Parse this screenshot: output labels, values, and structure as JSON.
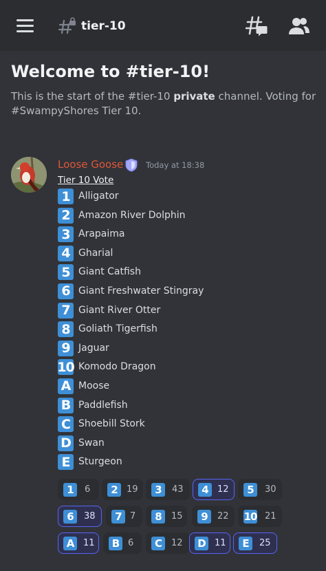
{
  "header": {
    "channel_name": "tier-10",
    "menu_icon": "hamburger-menu-icon",
    "channel_icon": "locked-hashtag-icon",
    "threads_icon": "threads-icon",
    "members_icon": "members-icon"
  },
  "welcome": {
    "title": "Welcome to #tier-10!",
    "desc_prefix": "This is the start of the #tier-10 ",
    "desc_bold": "private",
    "desc_suffix": " channel. Voting for #SwampyShores Tier 10."
  },
  "message": {
    "author": "Loose Goose",
    "author_color": "#e0573a",
    "badge_icon": "shield-badge-icon",
    "timestamp": "Today at 18:38",
    "title": "Tier 10 Vote",
    "options": [
      {
        "key": "1",
        "label": "Alligator"
      },
      {
        "key": "2",
        "label": "Amazon River Dolphin"
      },
      {
        "key": "3",
        "label": "Arapaima"
      },
      {
        "key": "4",
        "label": "Gharial"
      },
      {
        "key": "5",
        "label": "Giant Catfish"
      },
      {
        "key": "6",
        "label": "Giant Freshwater Stingray"
      },
      {
        "key": "7",
        "label": "Giant River Otter"
      },
      {
        "key": "8",
        "label": "Goliath Tigerfish"
      },
      {
        "key": "9",
        "label": "Jaguar"
      },
      {
        "key": "10",
        "label": "Komodo Dragon"
      },
      {
        "key": "A",
        "label": "Moose"
      },
      {
        "key": "B",
        "label": "Paddlefish"
      },
      {
        "key": "C",
        "label": "Shoebill Stork"
      },
      {
        "key": "D",
        "label": "Swan"
      },
      {
        "key": "E",
        "label": "Sturgeon"
      }
    ]
  },
  "reactions": [
    {
      "key": "1",
      "count": "6",
      "active": false
    },
    {
      "key": "2",
      "count": "19",
      "active": false
    },
    {
      "key": "3",
      "count": "43",
      "active": false
    },
    {
      "key": "4",
      "count": "12",
      "active": true
    },
    {
      "key": "5",
      "count": "30",
      "active": false
    },
    {
      "key": "6",
      "count": "38",
      "active": true
    },
    {
      "key": "7",
      "count": "7",
      "active": false
    },
    {
      "key": "8",
      "count": "15",
      "active": false
    },
    {
      "key": "9",
      "count": "22",
      "active": false
    },
    {
      "key": "10",
      "count": "21",
      "active": false
    },
    {
      "key": "A",
      "count": "11",
      "active": true
    },
    {
      "key": "B",
      "count": "6",
      "active": false
    },
    {
      "key": "C",
      "count": "12",
      "active": false
    },
    {
      "key": "D",
      "count": "11",
      "active": true
    },
    {
      "key": "E",
      "count": "25",
      "active": true
    }
  ],
  "colors": {
    "keycap": "#3e8fd6",
    "active_reaction_border": "#5865f2",
    "background": "#313338"
  }
}
